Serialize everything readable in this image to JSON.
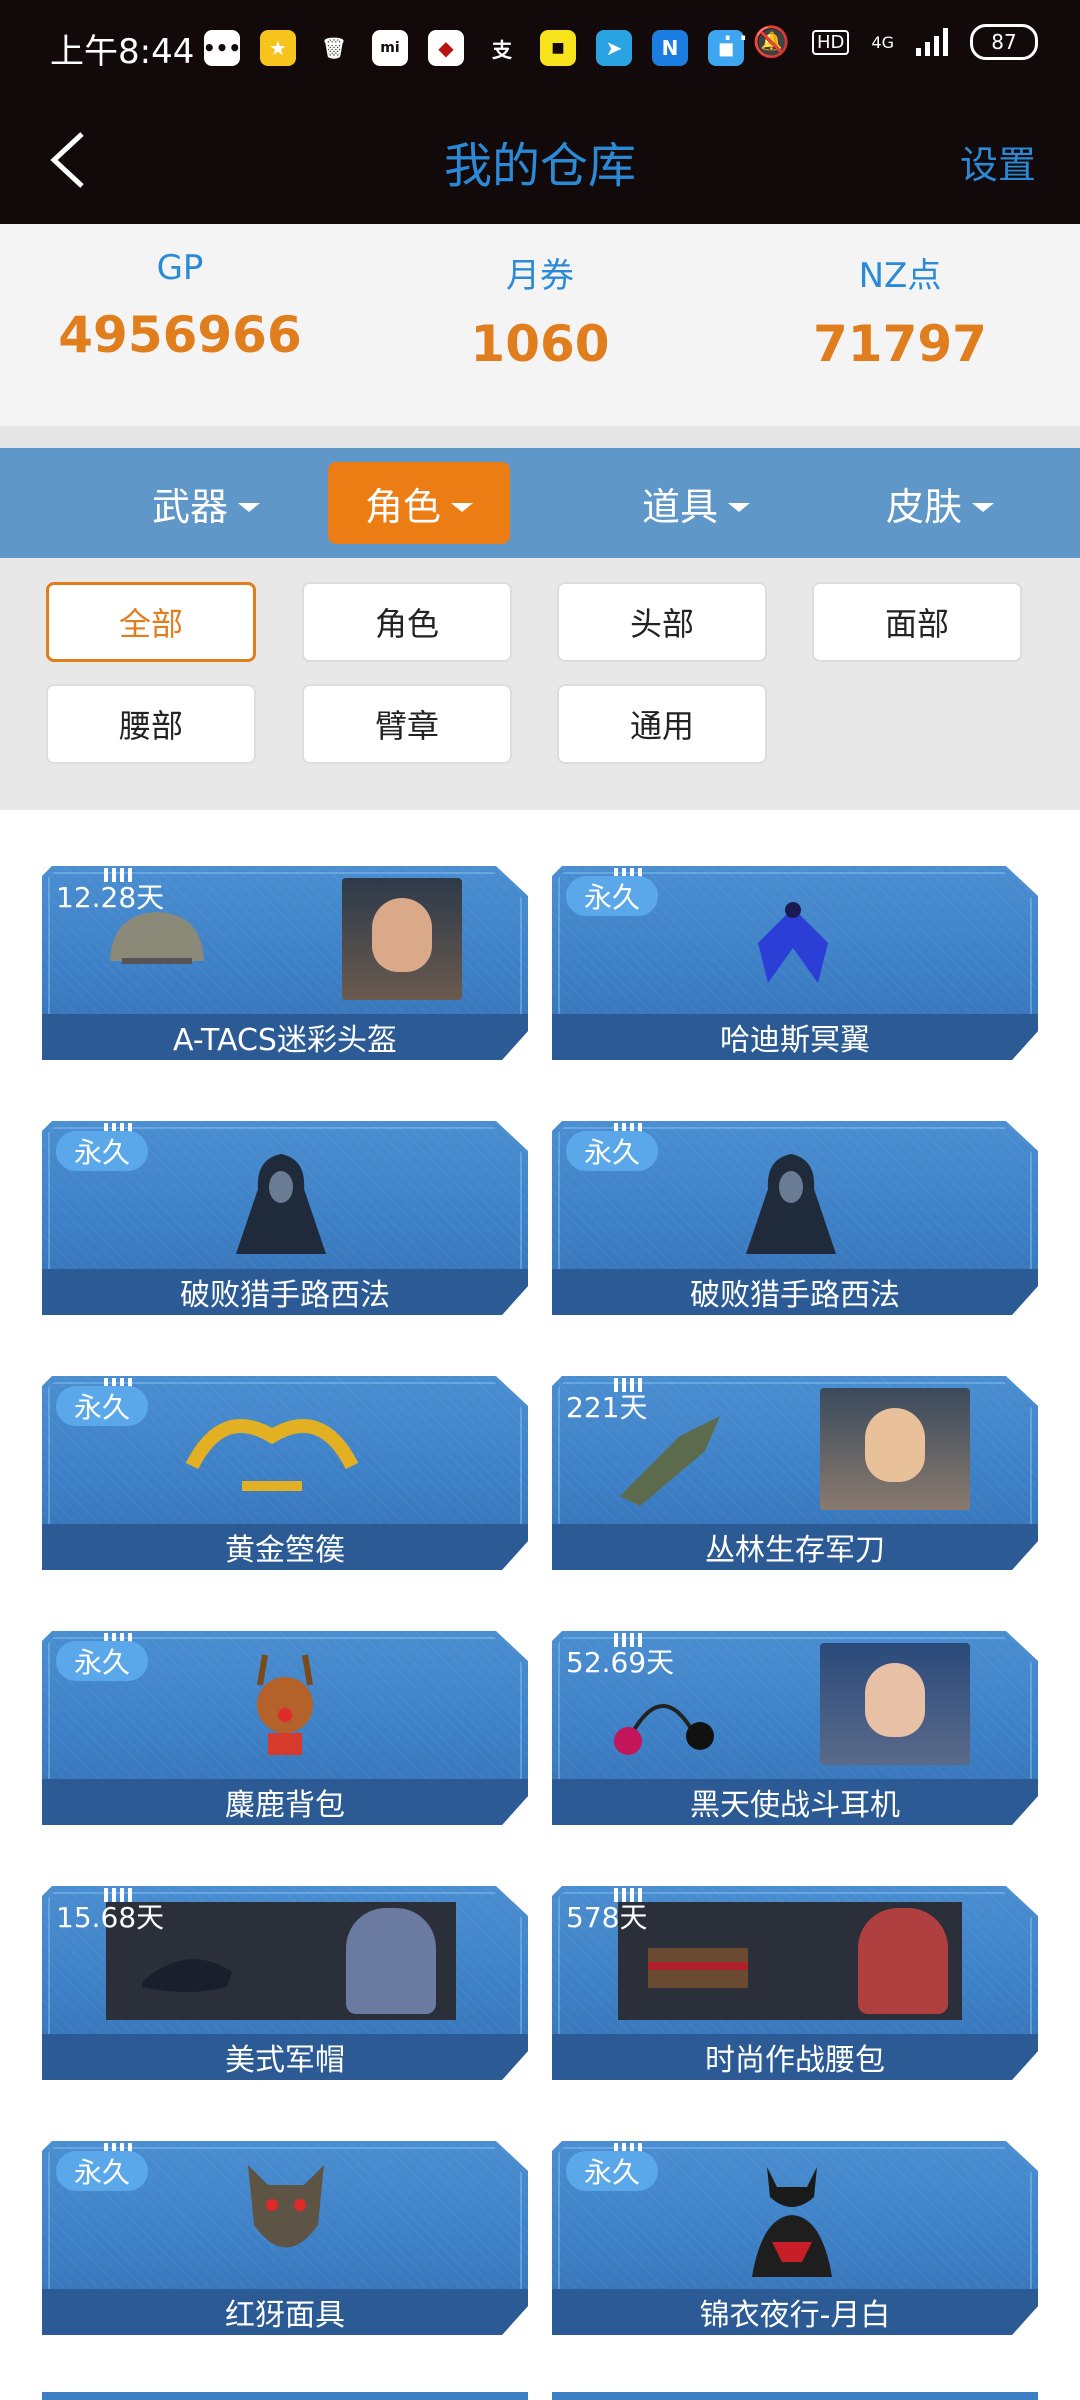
{
  "status_bar": {
    "time": "上午8:44",
    "network": "4G",
    "battery": "87",
    "icons": [
      "message-icon",
      "star-app-icon",
      "trash-icon",
      "mi-icon",
      "app-icon",
      "alipay-icon",
      "app-icon-yellow",
      "telegram-icon",
      "n-app-icon",
      "app-icon-blue",
      "more-icon",
      "mute-icon",
      "hd-icon",
      "signal-icon"
    ]
  },
  "header": {
    "title": "我的仓库",
    "settings": "设置"
  },
  "currency": [
    {
      "label": "GP",
      "value": "4956966"
    },
    {
      "label": "月券",
      "value": "1060"
    },
    {
      "label": "NZ点",
      "value": "71797"
    }
  ],
  "category_tabs": [
    {
      "label": "武器",
      "active": false
    },
    {
      "label": "角色",
      "active": true
    },
    {
      "label": "道具",
      "active": false
    },
    {
      "label": "皮肤",
      "active": false
    }
  ],
  "filters": [
    {
      "label": "全部",
      "active": true
    },
    {
      "label": "角色",
      "active": false
    },
    {
      "label": "头部",
      "active": false
    },
    {
      "label": "面部",
      "active": false
    },
    {
      "label": "腰部",
      "active": false
    },
    {
      "label": "臂章",
      "active": false
    },
    {
      "label": "通用",
      "active": false
    }
  ],
  "items": [
    {
      "name": "A-TACS迷彩头盔",
      "duration": "12.28天"
    },
    {
      "name": "哈迪斯冥翼",
      "duration": "永久"
    },
    {
      "name": "破败猎手路西法",
      "duration": "永久"
    },
    {
      "name": "破败猎手路西法",
      "duration": "永久"
    },
    {
      "name": "黄金箜篌",
      "duration": "永久"
    },
    {
      "name": "丛林生存军刀",
      "duration": "221天"
    },
    {
      "name": "麋鹿背包",
      "duration": "永久"
    },
    {
      "name": "黑天使战斗耳机",
      "duration": "52.69天"
    },
    {
      "name": "美式军帽",
      "duration": "15.68天"
    },
    {
      "name": "时尚作战腰包",
      "duration": "578天"
    },
    {
      "name": "红犽面具",
      "duration": "永久"
    },
    {
      "name": "锦衣夜行-月白",
      "duration": "永久"
    }
  ]
}
